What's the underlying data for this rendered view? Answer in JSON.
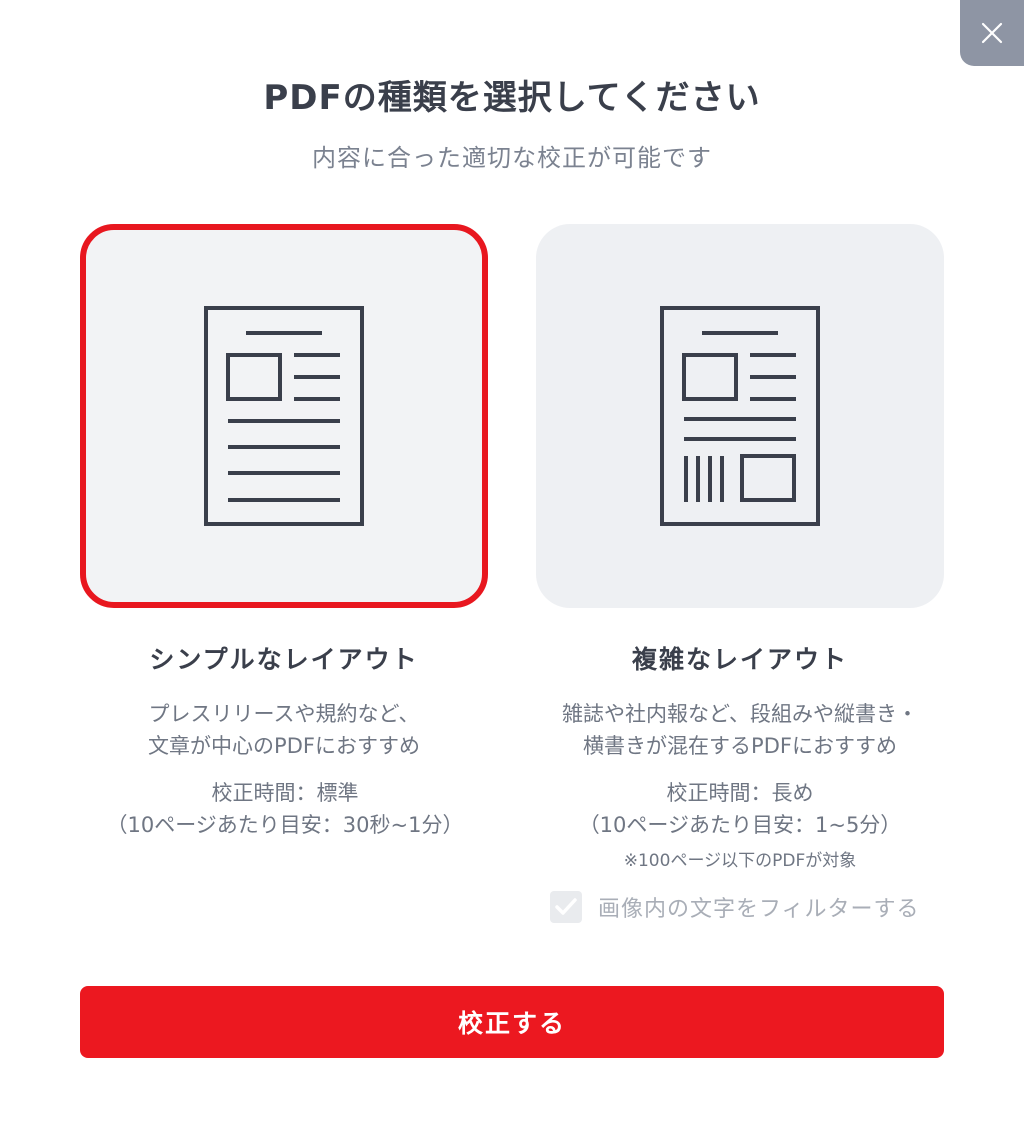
{
  "modal": {
    "title": "PDFの種類を選択してください",
    "subtitle": "内容に合った適切な校正が可能です",
    "close_icon": "close-icon"
  },
  "options": [
    {
      "key": "simple",
      "title": "シンプルなレイアウト",
      "desc_line1": "プレスリリースや規約など、",
      "desc_line2": "文章が中心のPDFにおすすめ",
      "time_line1": "校正時間：標準",
      "time_line2": "（10ページあたり目安：30秒~1分）",
      "selected": true,
      "icon": "simple-layout-document-icon"
    },
    {
      "key": "complex",
      "title": "複雑なレイアウト",
      "desc_line1": "雑誌や社内報など、段組みや縦書き・",
      "desc_line2": "横書きが混在するPDFにおすすめ",
      "time_line1": "校正時間：長め",
      "time_line2": "（10ページあたり目安：1~5分）",
      "note": "※100ページ以下のPDFが対象",
      "selected": false,
      "icon": "complex-layout-document-icon"
    }
  ],
  "filter": {
    "label": "画像内の文字をフィルターする",
    "checked": true,
    "disabled": true
  },
  "submit": {
    "label": "校正する"
  },
  "colors": {
    "accent": "#ec1820",
    "selected_border": "#e8171f",
    "card_bg": "#eef0f3",
    "close_bg": "#8e95a4",
    "text_dark": "#3a3f4b",
    "text_muted": "#6f7683"
  }
}
